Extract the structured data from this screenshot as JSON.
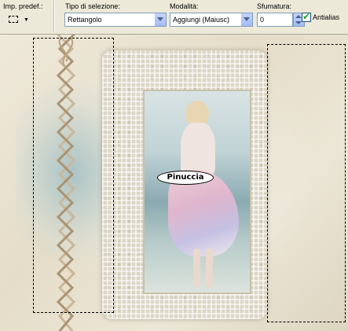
{
  "toolbar": {
    "preset_label": "Imp. predef.:",
    "selection_type": {
      "label": "Tipo di selezione:",
      "value": "Rettangolo"
    },
    "mode": {
      "label": "Modalità:",
      "value": "Aggiungi (Maiusc)"
    },
    "feather": {
      "label": "Sfumatura:",
      "value": "0"
    },
    "antialias": {
      "label": "Antialias",
      "checked": true
    }
  },
  "canvas": {
    "watermark": "Pinuccia"
  },
  "colors": {
    "toolbar_bg": "#ece9d8",
    "combo_button": "#a3bcf7",
    "checkbox_tick": "#21a121",
    "lace": "#dcd6c6"
  }
}
